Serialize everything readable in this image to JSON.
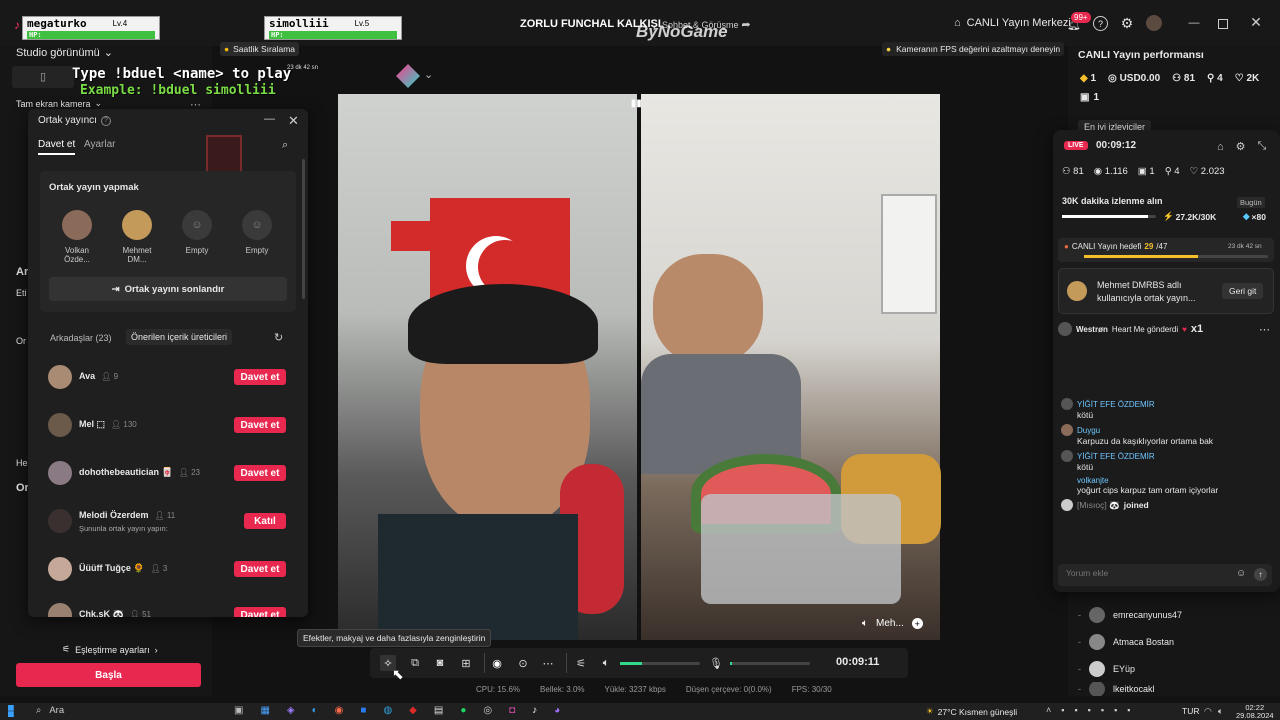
{
  "title_bar": {
    "stream_title": "ZORLU FUNCHAL KALKIŞI",
    "sohbet": "Sohbet & Görüşme",
    "watermark": "ByNoGame",
    "live_center": "CANLI Yayın Merkezi",
    "notif_badge": "99+"
  },
  "game_overlay": {
    "players": [
      {
        "name": "megaturko",
        "level": "Lv.4",
        "hp_label": "HP:"
      },
      {
        "name": "simolliii",
        "level": "Lv.5",
        "hp_label": "HP:"
      }
    ],
    "instruction": "Type !bduel <name> to play",
    "example": "Example: !bduel simolliii",
    "hourly_ranking": "Saatlik Sıralama",
    "small_timer": "23 dk 42 sn"
  },
  "left_panel": {
    "studio_view": "Studio görünümü",
    "camera": "Tam ekran kamera",
    "side_letters": [
      "Ar",
      "Eti",
      "Or",
      "He",
      "Or"
    ],
    "match_settings": "Eşleştirme ayarları",
    "start_button": "Başla"
  },
  "cohost": {
    "title": "Ortak yayıncı",
    "tabs": [
      "Davet et",
      "Ayarlar"
    ],
    "section_title": "Ortak yayın yapmak",
    "slots": [
      {
        "name": "Volkan Özde..."
      },
      {
        "name": "Mehmet DM..."
      },
      {
        "name": "Empty"
      },
      {
        "name": "Empty"
      }
    ],
    "end_button": "Ortak yayını sonlandır",
    "friends_tab": "Arkadaşlar (23)",
    "suggested_tab": "Önerilen içerik üreticileri",
    "friends": [
      {
        "name": "Ava",
        "count": "9",
        "action": "Davet et",
        "sub": ""
      },
      {
        "name": "Mel ⬚",
        "count": "130",
        "action": "Davet et",
        "sub": ""
      },
      {
        "name": "dohothebeautician 🀄",
        "count": "23",
        "action": "Davet et",
        "sub": ""
      },
      {
        "name": "Melodi Özerdem",
        "count": "11",
        "action": "Katıl",
        "sub": "Şununla ortak yayın yapın:"
      },
      {
        "name": "Üüüff Tuğçe 🌻",
        "count": "3",
        "action": "Davet et",
        "sub": ""
      },
      {
        "name": "Chk.sK 🐼",
        "count": "51",
        "action": "Davet et",
        "sub": ""
      }
    ]
  },
  "center": {
    "fps_tip": "Kameranın FPS değerini azaltmayı deneyin",
    "right_video_label": "Meh...",
    "effects_tooltip": "Efektler, makyaj ve daha fazlasıyla zenginleştirin",
    "timer": "00:09:11"
  },
  "stats_bar": {
    "cpu": "CPU: 15.6%",
    "memory": "Bellek: 3.0%",
    "upload": "Yükle: 3237 kbps",
    "dropped": "Düşen çerçeve: 0(0.0%)",
    "fps": "FPS: 30/30"
  },
  "right_panel": {
    "title": "CANLI Yayın performansı",
    "stats": [
      {
        "icon": "diamond-icon",
        "value": "1"
      },
      {
        "icon": "coin-icon",
        "value": "USD0.00"
      },
      {
        "icon": "people-icon",
        "value": "81"
      },
      {
        "icon": "person-add-icon",
        "value": "4"
      },
      {
        "icon": "heart-icon",
        "value": "2K"
      },
      {
        "icon": "gift-icon",
        "value": "1"
      }
    ],
    "top_viewers": "En iyi izleyiciler",
    "viewers": [
      "emrecanyunus47",
      "Atmaca Bostan",
      "EYüp",
      "lkeitkocakl"
    ]
  },
  "live_panel": {
    "live_badge": "LIVE",
    "timer": "00:09:12",
    "stats": [
      {
        "icon": "people-icon",
        "value": "81"
      },
      {
        "icon": "eye-icon",
        "value": "1.116"
      },
      {
        "icon": "gift-icon",
        "value": "1"
      },
      {
        "icon": "person-add-icon",
        "value": "4"
      },
      {
        "icon": "heart-icon",
        "value": "2.023"
      }
    ],
    "goal_title": "30K dakika izlenme alın",
    "goal_tag": "Bugün",
    "goal_value": "27.2K/30K",
    "goal_reward": "×80",
    "live_goal": "CANLI Yayın hedefi",
    "live_goal_current": "29",
    "live_goal_total": "/47",
    "live_goal_time": "23 dk 42 sn",
    "cohost_notice": "Mehmet DMRBS adlı kullanıcıyla ortak yayın...",
    "back_button": "Geri git",
    "gift_line_user": "Westrøn",
    "gift_line_text": "Heart Me gönderdi",
    "gift_count": "x1",
    "chat": [
      {
        "user": "YİĞİT EFE ÖZDEMİR",
        "text": "kötü"
      },
      {
        "user": "Duygu",
        "text": "Karpuzu da kaşıklıyorlar ortama bak"
      },
      {
        "user": "YİĞİT EFE ÖZDEMİR",
        "text": "kötü"
      },
      {
        "user": "volkanjte",
        "text": "yoğurt cips karpuz tam ortam içiyorlar"
      },
      {
        "user": "[Mısıoç] 🐼",
        "text": "joined"
      }
    ],
    "comment_placeholder": "Yorum ekle"
  },
  "taskbar": {
    "search": "Ara",
    "weather": "27°C  Kısmen güneşli",
    "lang": "TUR",
    "time": "02:22",
    "date": "29.08.2024"
  }
}
